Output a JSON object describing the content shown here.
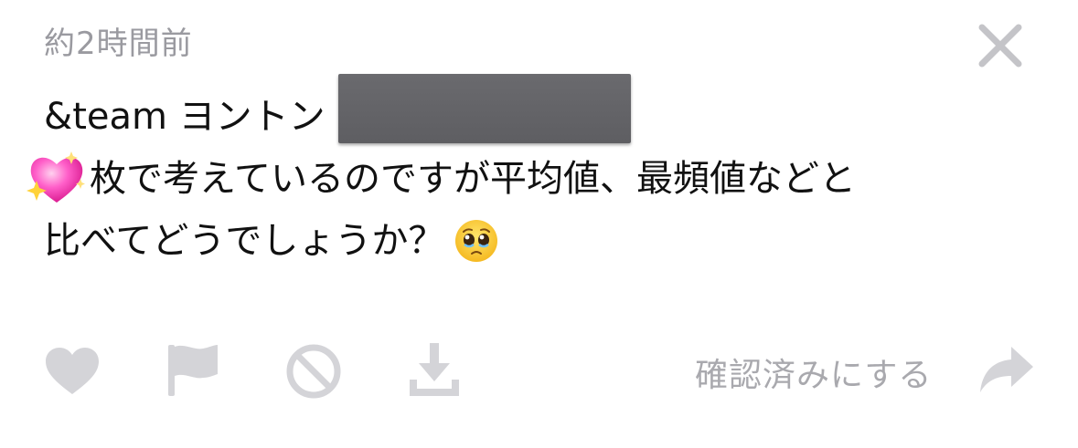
{
  "header": {
    "timestamp": "約2時間前",
    "close_icon": "close-icon"
  },
  "message": {
    "line1_text": "&team ヨントン",
    "line2_text": "枚で考えているのですが平均値、最頻値などと",
    "line3_text": "比べてどうでしょうか？",
    "emojis": [
      "sparkling-heart-emoji",
      "pleading-face-emoji"
    ]
  },
  "actions": {
    "icons": [
      "heart-icon",
      "flag-icon",
      "block-icon",
      "download-icon",
      "share-arrow-icon"
    ],
    "confirm_label": "確認済みにする"
  },
  "colors": {
    "icon_gray": "#d4d4d8",
    "label_gray": "#a9a9ae",
    "timestamp_gray": "#9a9aa0",
    "text": "#111111",
    "redaction": "#616165"
  }
}
